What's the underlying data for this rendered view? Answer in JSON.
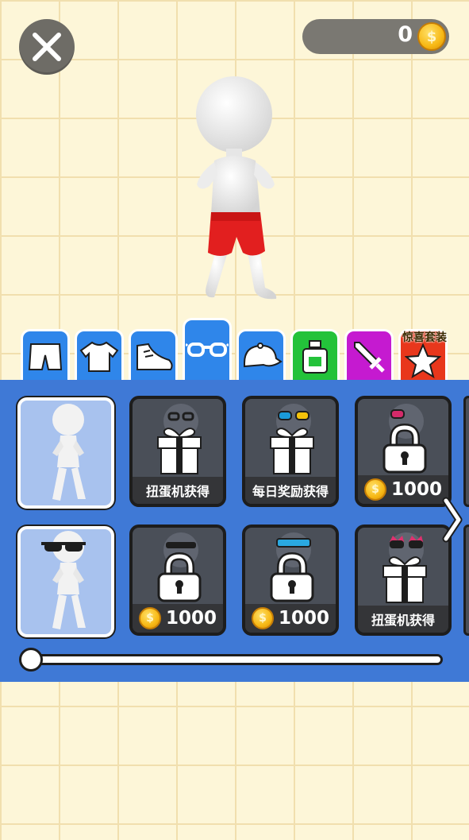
{
  "coins": {
    "count": "0",
    "symbol": "$"
  },
  "tabs": [
    {
      "name": "shorts",
      "icon": "shorts-icon",
      "color": "#2f86ea",
      "active": false
    },
    {
      "name": "shirt",
      "icon": "shirt-icon",
      "color": "#2f86ea",
      "active": false
    },
    {
      "name": "shoes",
      "icon": "shoe-icon",
      "color": "#2f86ea",
      "active": false
    },
    {
      "name": "glasses",
      "icon": "glasses-icon",
      "color": "#2f86ea",
      "active": true
    },
    {
      "name": "hat",
      "icon": "cap-icon",
      "color": "#2f86ea",
      "active": false
    },
    {
      "name": "potion",
      "icon": "potion-icon",
      "color": "#23c23a",
      "active": false
    },
    {
      "name": "weapon",
      "icon": "sword-icon",
      "color": "#c51ad0",
      "active": false
    },
    {
      "name": "surprise-suit",
      "icon": "star-icon",
      "color": "#e8371c",
      "active": false
    }
  ],
  "suit_label": "惊喜套装",
  "items": {
    "row1": [
      {
        "type": "preview"
      },
      {
        "type": "gift",
        "caption": "扭蛋机获得"
      },
      {
        "type": "gift",
        "caption": "每日奖励获得"
      },
      {
        "type": "locked",
        "price": "1000"
      }
    ],
    "row2": [
      {
        "type": "preview-sunglasses"
      },
      {
        "type": "locked",
        "price": "1000"
      },
      {
        "type": "locked",
        "price": "1000"
      },
      {
        "type": "gift",
        "caption": "扭蛋机获得"
      }
    ]
  },
  "scroll_position": 0,
  "colors": {
    "background": "#fdf6d8",
    "panel": "#3f79d6",
    "shorts": "#e21f1f",
    "coin": "#f7b814"
  }
}
